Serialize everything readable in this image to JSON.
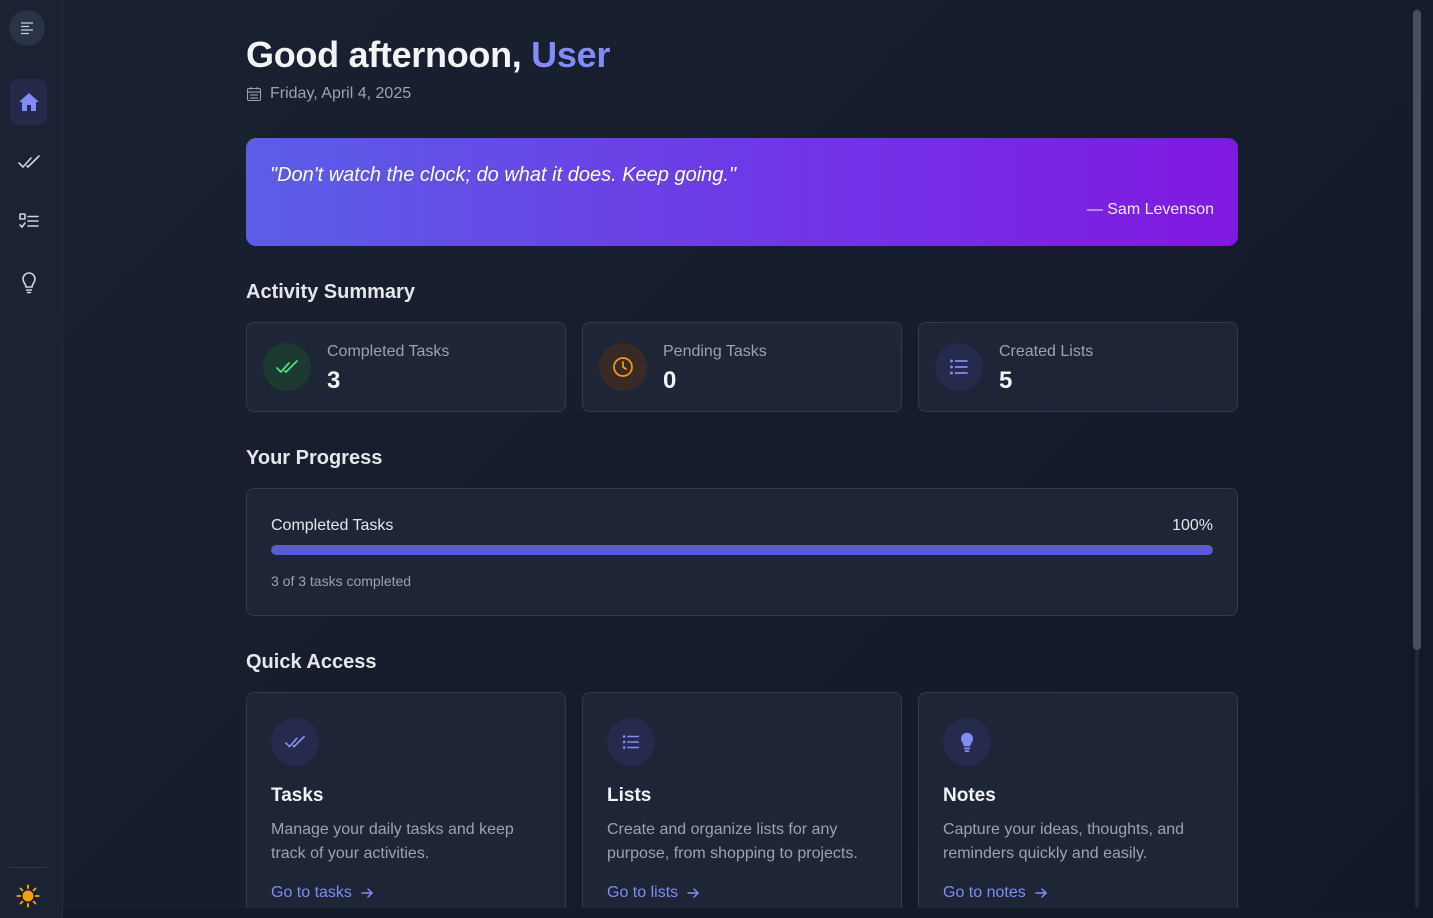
{
  "greeting": {
    "prefix": "Good afternoon,",
    "name": "User"
  },
  "date": "Friday, April 4, 2025",
  "quote": {
    "text": "\"Don't watch the clock; do what it does. Keep going.\"",
    "author": "— Sam Levenson"
  },
  "sections": {
    "activity": "Activity Summary",
    "progress": "Your Progress",
    "quick_access": "Quick Access"
  },
  "stats": [
    {
      "label": "Completed Tasks",
      "value": "3",
      "icon": "double-check-icon",
      "color": "#4ade80"
    },
    {
      "label": "Pending Tasks",
      "value": "0",
      "icon": "clock-icon",
      "color": "#f59e0b"
    },
    {
      "label": "Created Lists",
      "value": "5",
      "icon": "list-icon",
      "color": "#818cf8"
    }
  ],
  "progress": {
    "label": "Completed Tasks",
    "percent_label": "100%",
    "fraction": 1.0,
    "note": "3 of 3 tasks completed"
  },
  "quick_access": [
    {
      "title": "Tasks",
      "desc": "Manage your daily tasks and keep track of your activities.",
      "link": "Go to tasks",
      "icon": "double-check-icon"
    },
    {
      "title": "Lists",
      "desc": "Create and organize lists for any purpose, from shopping to projects.",
      "link": "Go to lists",
      "icon": "list-icon"
    },
    {
      "title": "Notes",
      "desc": "Capture your ideas, thoughts, and reminders quickly and easily.",
      "link": "Go to notes",
      "icon": "lightbulb-icon"
    }
  ],
  "sidebar": {
    "items": [
      "home-icon",
      "double-check-icon",
      "checklist-icon",
      "lightbulb-icon"
    ],
    "theme": "sun-icon"
  },
  "colors": {
    "accent": "#818cf8",
    "bar": "#5b5bd6"
  }
}
